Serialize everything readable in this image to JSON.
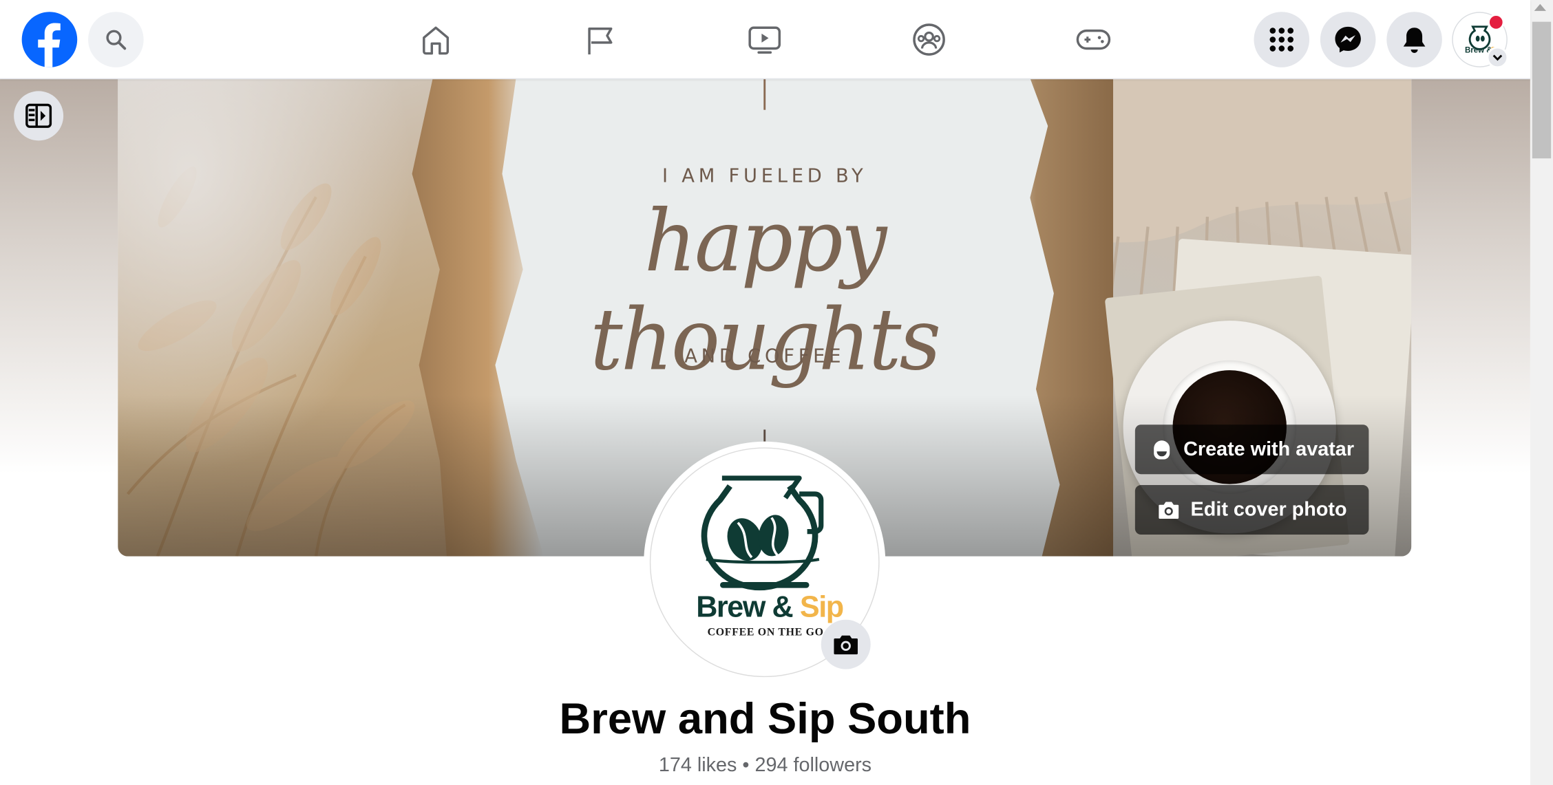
{
  "header": {
    "logo_icon": "facebook-logo-icon",
    "search_icon": "search-icon",
    "nav": [
      {
        "icon": "home-icon"
      },
      {
        "icon": "pages-flag-icon"
      },
      {
        "icon": "video-icon"
      },
      {
        "icon": "groups-icon"
      },
      {
        "icon": "gaming-icon"
      }
    ],
    "menu_icon": "menu-grid-icon",
    "messenger_icon": "messenger-icon",
    "notifications_icon": "bell-icon",
    "account_icon": "account-avatar",
    "brand_color": "#0866ff"
  },
  "cover": {
    "quote_line1": "I AM FUELED BY",
    "quote_script": "happy thoughts",
    "quote_line2": "AND COFFEE",
    "create_avatar_label": "Create with avatar",
    "edit_cover_label": "Edit cover photo"
  },
  "profile": {
    "logo_brand_part1": "Brew &",
    "logo_brand_part2": "Sip",
    "logo_tagline": "COFFEE ON THE GO",
    "name": "Brew and Sip South",
    "stats": "174 likes • 294 followers"
  }
}
